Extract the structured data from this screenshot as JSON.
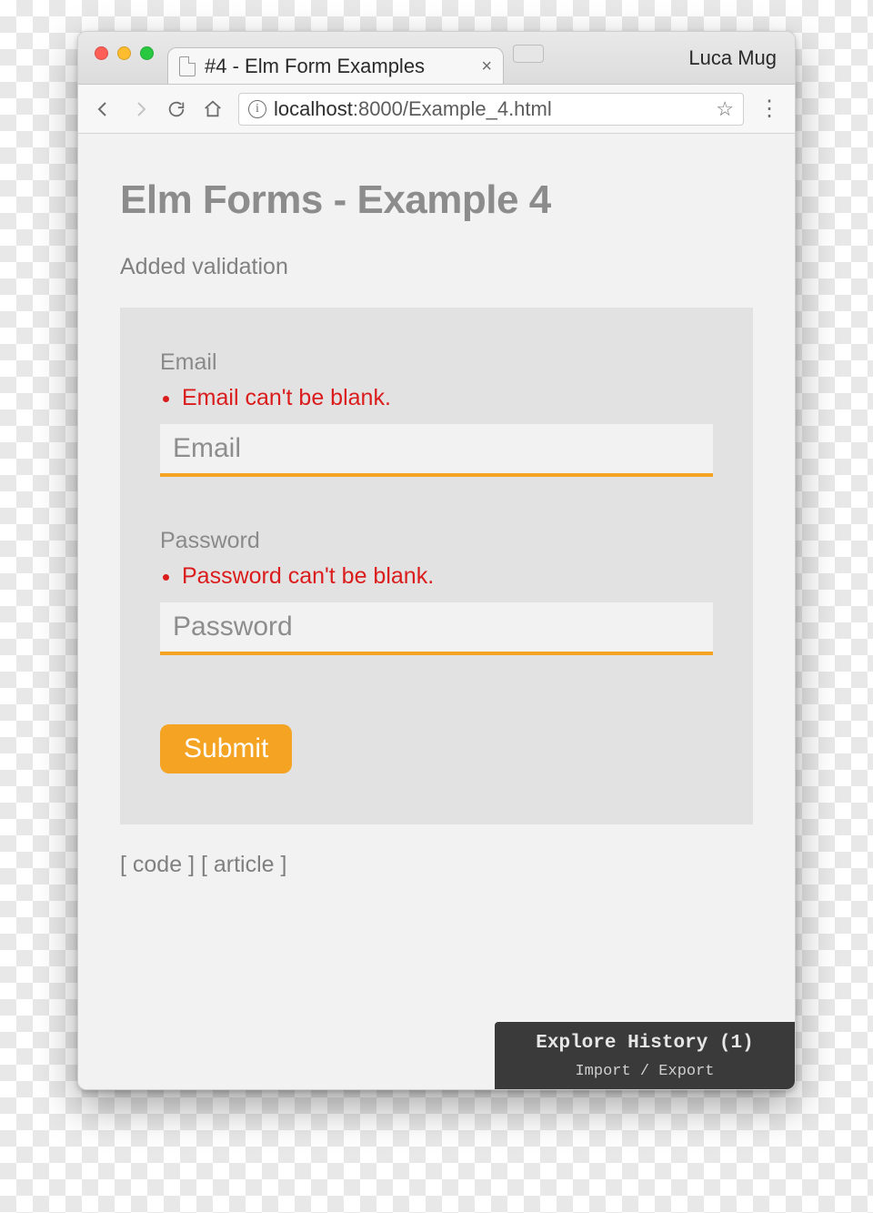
{
  "browser": {
    "tab_title": "#4 - Elm Form Examples",
    "profile_name": "Luca Mug",
    "url_host": "localhost",
    "url_port_path": ":8000/Example_4.html"
  },
  "page": {
    "heading": "Elm Forms - Example 4",
    "subtitle": "Added validation",
    "form": {
      "email": {
        "label": "Email",
        "error": "Email can't be blank.",
        "placeholder": "Email",
        "value": ""
      },
      "password": {
        "label": "Password",
        "error": "Password can't be blank.",
        "placeholder": "Password",
        "value": ""
      },
      "submit_label": "Submit"
    },
    "footer": {
      "code_label": "code",
      "article_label": "article"
    },
    "debugger": {
      "title": "Explore History (1)",
      "sub": "Import / Export"
    }
  }
}
